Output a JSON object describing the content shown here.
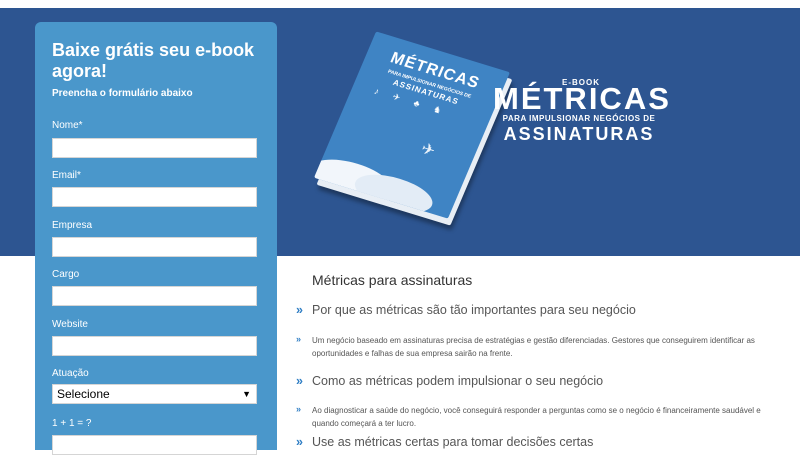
{
  "form": {
    "title": "Baixe grátis seu e-book agora!",
    "subtitle": "Preencha o formulário abaixo",
    "fields": [
      {
        "label": "Nome*",
        "value": ""
      },
      {
        "label": "Email*",
        "value": ""
      },
      {
        "label": "Empresa",
        "value": ""
      },
      {
        "label": "Cargo",
        "value": ""
      },
      {
        "label": "Website",
        "value": ""
      }
    ],
    "atuacao_label": "Atuação",
    "atuacao_value": "Selecione",
    "captcha_label": "1 + 1 = ?"
  },
  "banner": {
    "ebook_label": "E-BOOK",
    "title": "MÉTRICAS",
    "tagline": "PARA IMPULSIONAR NEGÓCIOS DE",
    "tagline_main": "ASSINATURAS",
    "book_title": "MÉTRICAS",
    "book_sub": "PARA IMPULSIONAR NEGÓCIOS DE",
    "book_sub2": "ASSINATURAS"
  },
  "content": {
    "heading": "Métricas para assinaturas",
    "items": [
      {
        "title": "Por que as métricas são tão importantes para seu negócio",
        "text": "Um negócio baseado em assinaturas precisa de estratégias e gestão diferenciadas. Gestores que conseguirem identificar as oportunidades e falhas de sua empresa sairão na frente."
      },
      {
        "title": "Como as métricas podem impulsionar o seu negócio",
        "text": "Ao diagnosticar a saúde do negócio, você conseguirá responder a perguntas como se o negócio é financeiramente saudável e quando começará a ter lucro."
      },
      {
        "title": "Use as métricas certas para tomar decisões certas",
        "text": ""
      }
    ]
  },
  "colors": {
    "banner": "#2d5591",
    "form": "#4a97cb",
    "accent": "#2f7ec4"
  }
}
